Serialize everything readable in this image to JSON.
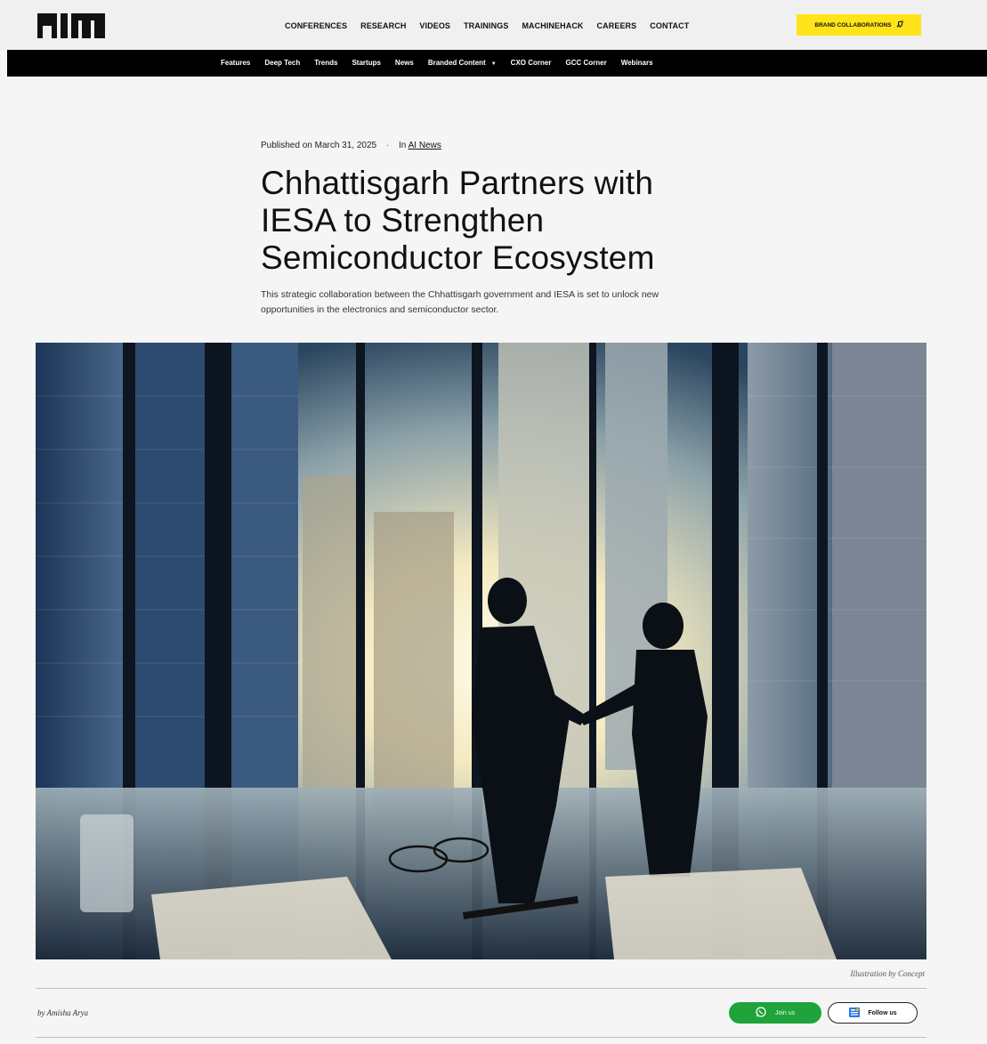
{
  "header": {
    "logo_text": "AIM",
    "nav": [
      "CONFERENCES",
      "RESEARCH",
      "VIDEOS",
      "TRAININGS",
      "MACHINEHACK",
      "CAREERS",
      "CONTACT"
    ],
    "brand_button_label": "BRAND COLLABORATIONS",
    "brand_color": "#ffe41a"
  },
  "subnav": {
    "items": [
      "Features",
      "Deep Tech",
      "Trends",
      "Startups",
      "News",
      "Branded Content",
      "CXO Corner",
      "GCC Corner",
      "Webinars"
    ],
    "dropdown_item": "Branded Content"
  },
  "article": {
    "published_prefix": "Published on",
    "published_date": "March 31, 2025",
    "category_prefix": "In",
    "category": "AI News",
    "title": "Chhattisgarh Partners with IESA to Strengthen Semiconductor Ecosystem",
    "subtitle": "This strategic collaboration between the Chhattisgarh government and IESA is set to unlock new opportunities in the electronics and semiconductor sector.",
    "image_caption": "Illustration by Concept",
    "byline": "by Amisha Arya"
  },
  "social": {
    "whatsapp_label": "Join us",
    "follow_label": "Follow us",
    "whatsapp_color": "#1fa33b"
  }
}
